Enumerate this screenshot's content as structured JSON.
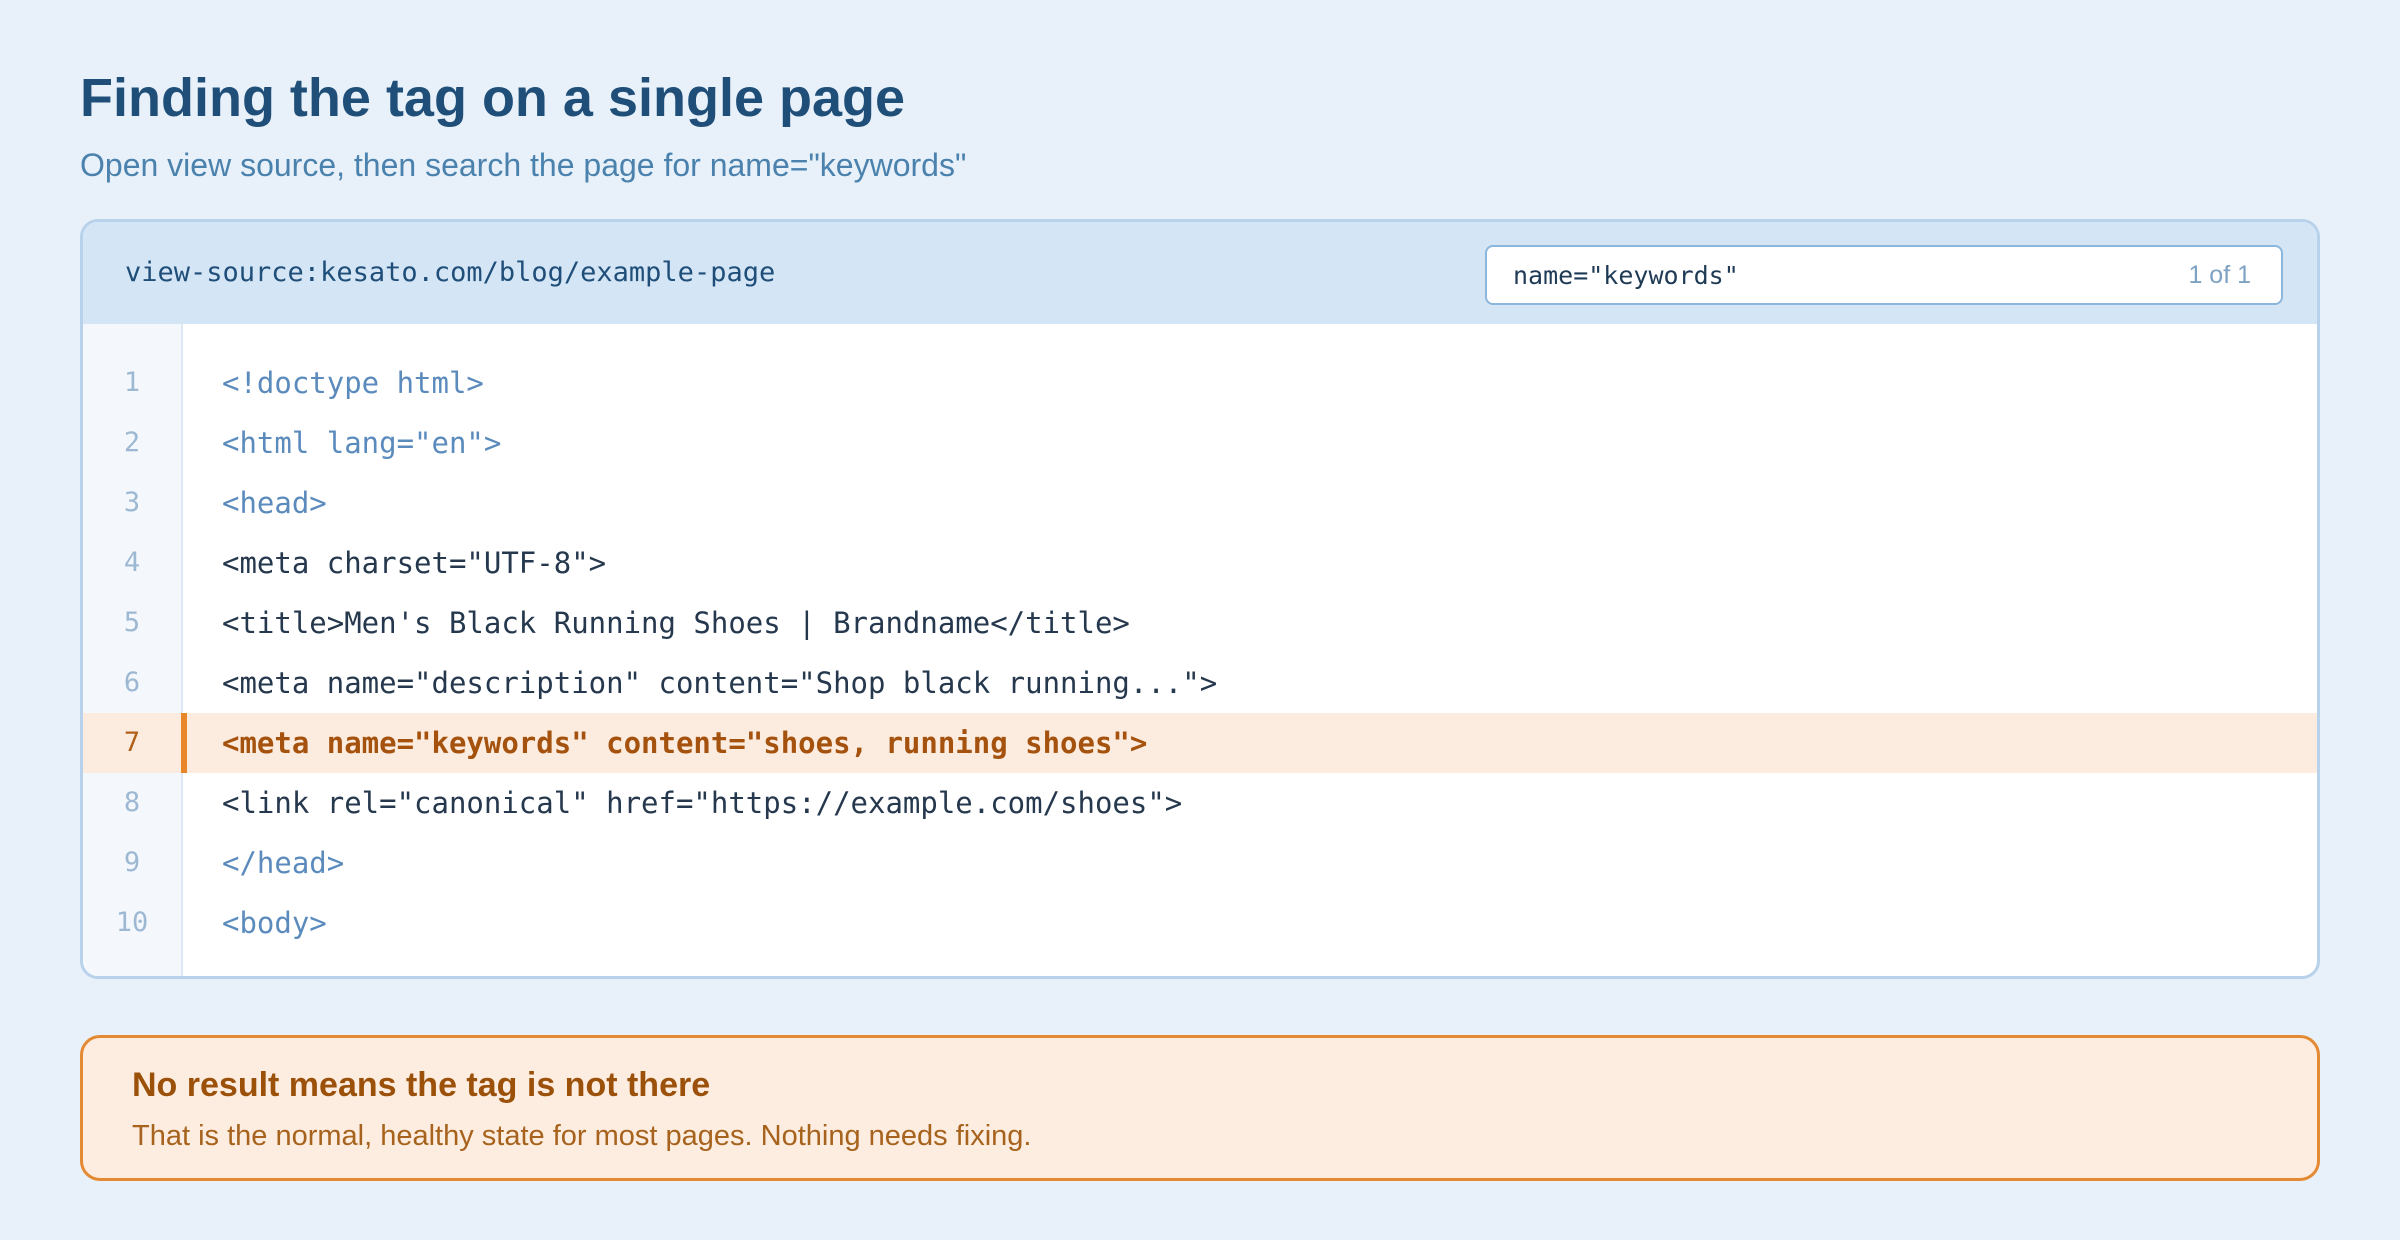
{
  "heading": {
    "title": "Finding the tag on a single page",
    "subtitle": "Open view source, then search the page for name=\"keywords\""
  },
  "source_view": {
    "url": "view-source:kesato.com/blog/example-page",
    "find": {
      "query": "name=\"keywords\"",
      "match_count": "1 of 1"
    },
    "lines": [
      {
        "number": "1",
        "text": "<!doctype html>"
      },
      {
        "number": "2",
        "text": "<html lang=\"en\">"
      },
      {
        "number": "3",
        "text": "<head>"
      },
      {
        "number": "4",
        "text": "<meta charset=\"UTF-8\">"
      },
      {
        "number": "5",
        "text": "<title>Men's Black Running Shoes | Brandname</title>"
      },
      {
        "number": "6",
        "text": "<meta name=\"description\" content=\"Shop black running...\">"
      },
      {
        "number": "7",
        "text": "<meta name=\"keywords\" content=\"shoes, running shoes\">"
      },
      {
        "number": "8",
        "text": "<link rel=\"canonical\" href=\"https://example.com/shoes\">"
      },
      {
        "number": "9",
        "text": "</head>"
      },
      {
        "number": "10",
        "text": "<body>"
      }
    ]
  },
  "note": {
    "title": "No result means the tag is not there",
    "body": "That is the normal, healthy state for most pages. Nothing needs fixing."
  },
  "colors": {
    "background": "#e8f1fa",
    "heading": "#1f4e79",
    "highlight_accent": "#e8862a",
    "highlight_background": "#fcecdf"
  }
}
